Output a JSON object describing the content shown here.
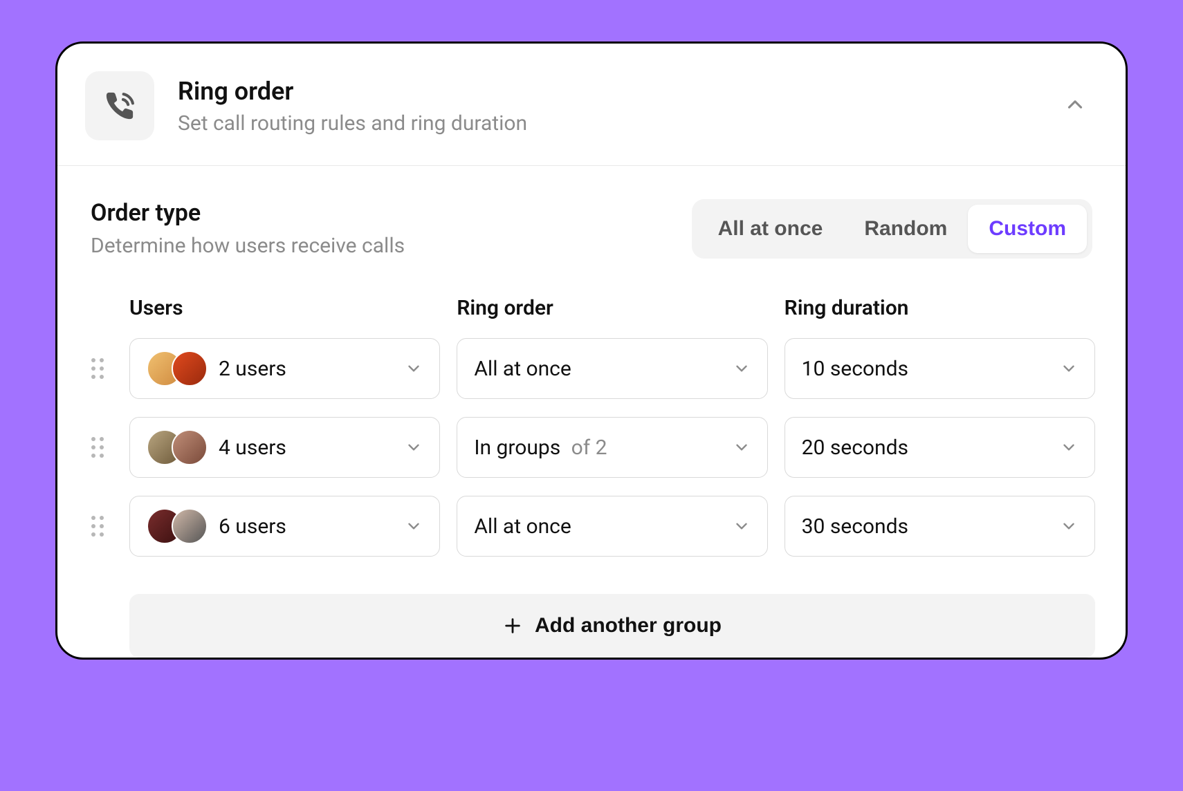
{
  "header": {
    "title": "Ring order",
    "subtitle": "Set call routing rules and ring duration"
  },
  "orderType": {
    "title": "Order type",
    "subtitle": "Determine how users receive calls",
    "options": [
      "All at once",
      "Random",
      "Custom"
    ],
    "selected": "Custom"
  },
  "columns": {
    "users": "Users",
    "ringOrder": "Ring order",
    "ringDuration": "Ring duration"
  },
  "rows": [
    {
      "usersLabel": "2 users",
      "ringOrder": "All at once",
      "ringOrderSuffix": "",
      "ringDuration": "10 seconds"
    },
    {
      "usersLabel": "4 users",
      "ringOrder": "In groups",
      "ringOrderSuffix": "of 2",
      "ringDuration": "20 seconds"
    },
    {
      "usersLabel": "6 users",
      "ringOrder": "All at once",
      "ringOrderSuffix": "",
      "ringDuration": "30 seconds"
    }
  ],
  "addButton": "Add another group"
}
